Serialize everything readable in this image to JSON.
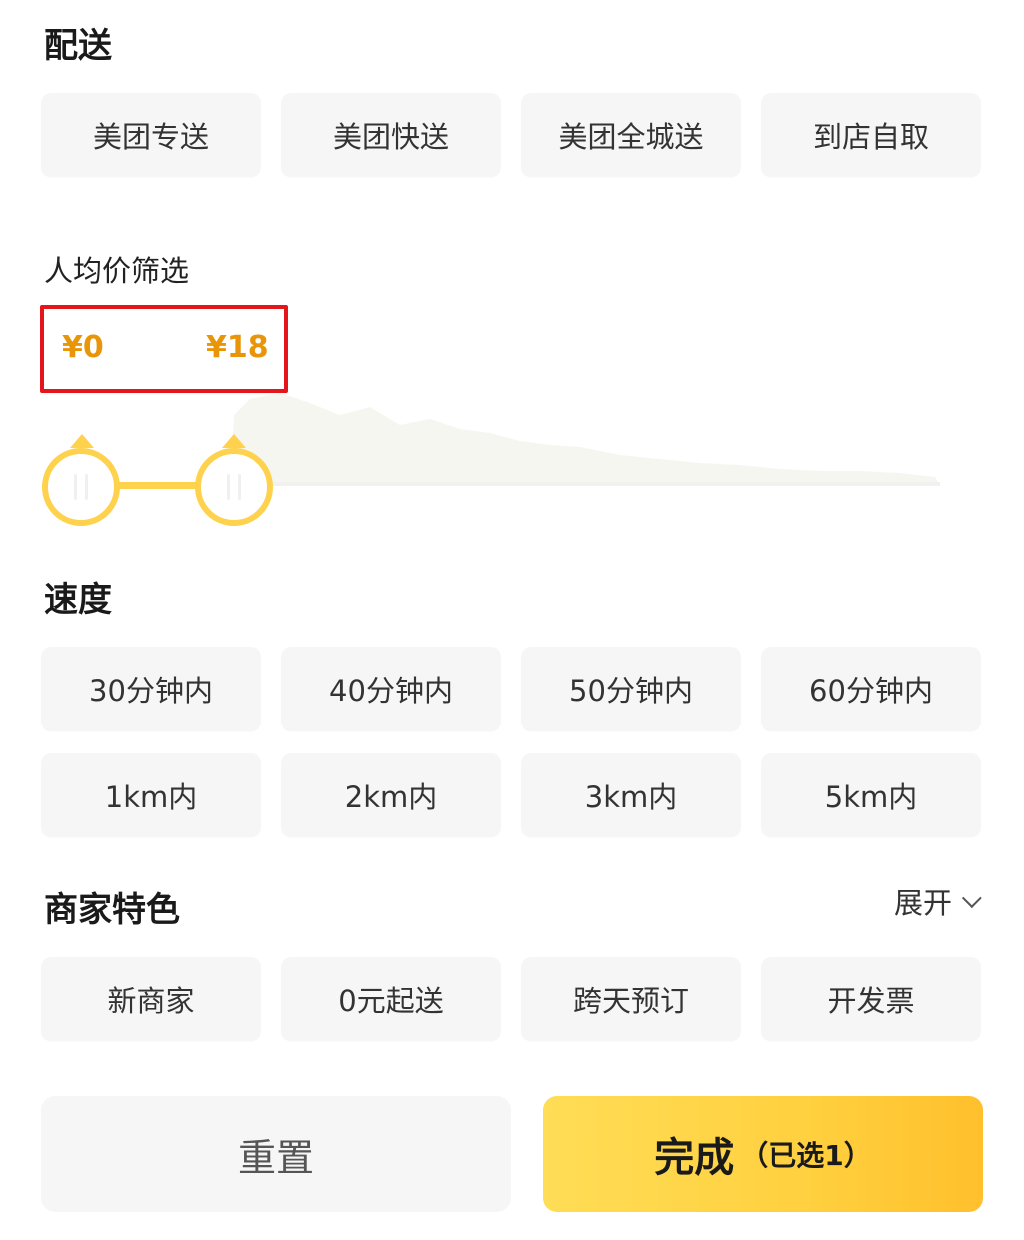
{
  "delivery": {
    "title": "配送",
    "options": [
      "美团专送",
      "美团快送",
      "美团全城送",
      "到店自取"
    ]
  },
  "price": {
    "title": "人均价筛选",
    "min_label": "¥0",
    "max_label": "¥18"
  },
  "speed": {
    "title": "速度",
    "time_options": [
      "30分钟内",
      "40分钟内",
      "50分钟内",
      "60分钟内"
    ],
    "distance_options": [
      "1km内",
      "2km内",
      "3km内",
      "5km内"
    ]
  },
  "features": {
    "title": "商家特色",
    "expand_label": "展开",
    "options": [
      "新商家",
      "0元起送",
      "跨天预订",
      "开发票"
    ]
  },
  "footer": {
    "reset_label": "重置",
    "done_label": "完成",
    "selected_label": "（已选1）"
  },
  "colors": {
    "accent": "#ffd24d",
    "price_text": "#e8950a",
    "highlight_box": "#e4151b"
  }
}
